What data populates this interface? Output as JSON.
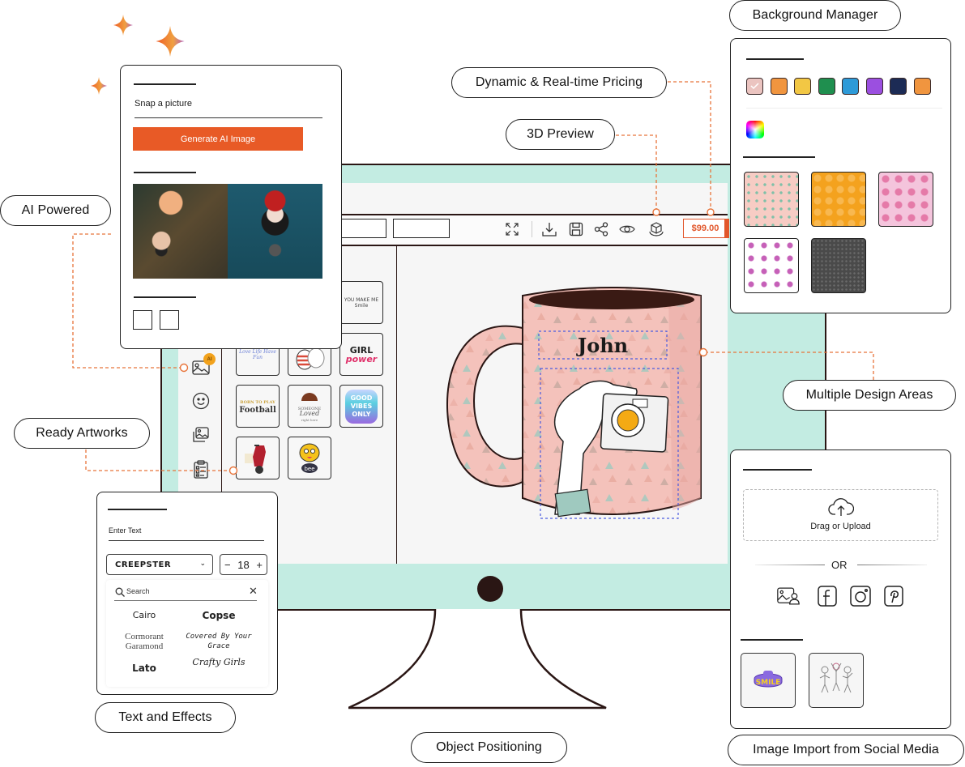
{
  "features": {
    "background_manager": "Background Manager",
    "dynamic_pricing": "Dynamic & Real-time Pricing",
    "preview_3d": "3D Preview",
    "ai_powered": "AI Powered",
    "multiple_design_areas": "Multiple Design Areas",
    "ready_artworks": "Ready Artworks",
    "text_and_effects": "Text and Effects",
    "object_positioning": "Object Positioning",
    "image_import": "Image Import from Social Media"
  },
  "ai_card": {
    "prompt_value": "Snap a picture",
    "generate_label": "Generate AI Image"
  },
  "toolbar": {
    "icons": [
      "fullscreen-icon",
      "download-icon",
      "save-icon",
      "share-icon",
      "preview-icon",
      "3d-preview-icon"
    ],
    "price": "$99.00"
  },
  "rail": {
    "items": [
      "ai-image-icon",
      "emoji-icon",
      "image-gallery-icon",
      "artwork-list-icon"
    ],
    "ai_badge": "AI"
  },
  "artworks": [
    {
      "label": "YOU MAKE ME Smile"
    },
    {
      "label": "Love Life Have Fun"
    },
    {
      "label": "Cat illustration"
    },
    {
      "label": "GIRL power"
    },
    {
      "label": "BORN TO PLAY Football"
    },
    {
      "label": "Loved"
    },
    {
      "label": "Good Vibes Only"
    },
    {
      "label": "Scooter"
    },
    {
      "label": "Bee"
    }
  ],
  "design": {
    "mug_text": "John"
  },
  "background_card": {
    "colors": [
      "#ebc4c0",
      "#f0953f",
      "#f2c744",
      "#1f8f4f",
      "#2d9ad8",
      "#9b4fe0",
      "#1c2b55",
      "#f0953f"
    ],
    "selected_color_index": 0,
    "patterns": [
      "pink-triangles",
      "orange-pattern",
      "pink-hearts",
      "owl-pattern",
      "dark-grey-pattern"
    ]
  },
  "text_card": {
    "text_placeholder": "Enter Text",
    "font_selected": "CREEPSTER",
    "font_size": "18",
    "search_placeholder": "Search",
    "fonts": [
      "Cairo",
      "Copse",
      "Cormorant Garamond",
      "Covered By Your Grace",
      "Lato",
      "Crafty Girls"
    ]
  },
  "import_card": {
    "upload_label": "Drag or Upload",
    "or_label": "OR",
    "sources": [
      "gallery-icon",
      "facebook-icon",
      "instagram-icon",
      "pinterest-icon"
    ],
    "recent": [
      "Smile sticker",
      "Dancing kids sketch"
    ]
  }
}
